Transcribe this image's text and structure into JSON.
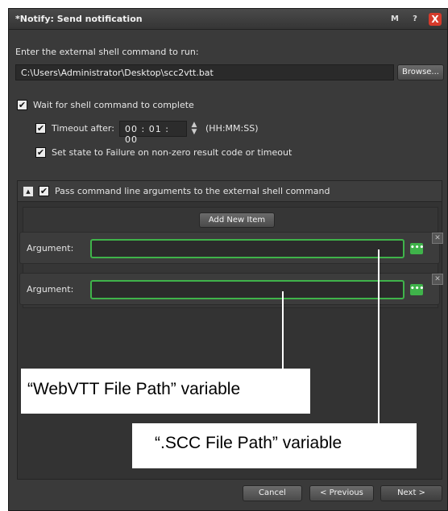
{
  "window": {
    "title": "*Notify: Send notification",
    "btn_m": "M",
    "btn_help": "?",
    "btn_close": "X"
  },
  "command": {
    "prompt": "Enter the external shell command to run:",
    "path": "C:\\Users\\Administrator\\Desktop\\scc2vtt.bat",
    "browse": "Browse..."
  },
  "options": {
    "wait": {
      "label": "Wait for shell command to complete",
      "checked": true
    },
    "timeout": {
      "label": "Timeout after:",
      "value": "00 : 01 : 00",
      "format": "(HH:MM:SS)",
      "checked": true
    },
    "failure": {
      "label": "Set state to Failure on non-zero result code or timeout",
      "checked": true
    }
  },
  "args_section": {
    "label": "Pass command line arguments to the external shell command",
    "checked": true,
    "add_button": "Add New Item",
    "arguments": [
      {
        "label": "Argument:",
        "value": ""
      },
      {
        "label": "Argument:",
        "value": ""
      }
    ]
  },
  "callouts": {
    "webvtt": "“WebVTT File Path” variable",
    "scc": "“.SCC File Path” variable"
  },
  "footer": {
    "cancel": "Cancel",
    "previous": "< Previous",
    "next": "Next >"
  },
  "colors": {
    "accent_green": "#3fb34a",
    "close_red": "#d63a2b",
    "panel": "#3a3a3a"
  }
}
